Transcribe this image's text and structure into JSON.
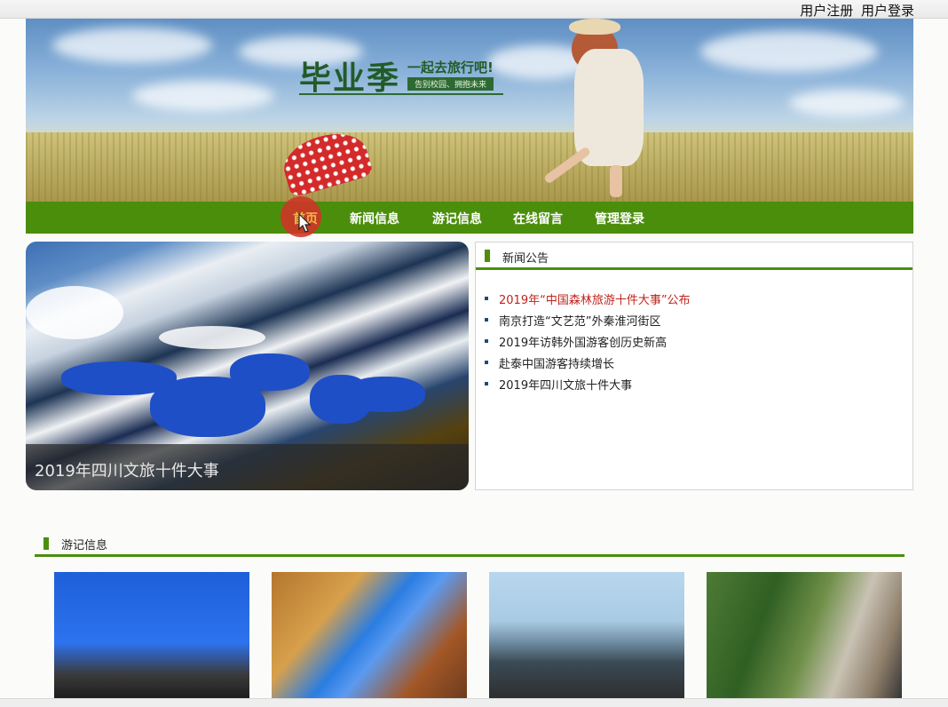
{
  "top": {
    "links": [
      "用户注册",
      "用户登录"
    ]
  },
  "banner": {
    "logo_main": "毕业季",
    "logo_sub": "一起去旅行吧!",
    "logo_tag": "告别校园、拥抱未来"
  },
  "nav": {
    "items": [
      "首页",
      "新闻信息",
      "游记信息",
      "在线留言",
      "管理登录"
    ],
    "active": "首页"
  },
  "hero": {
    "caption": "2019年四川文旅十件大事"
  },
  "news": {
    "title": "新闻公告",
    "items": [
      "2019年“中国森林旅游十件大事”公布",
      "南京打造“文艺范”外秦淮河街区",
      "2019年访韩外国游客创历史新高",
      "赴泰中国游客持续增长",
      "2019年四川文旅十件大事"
    ]
  },
  "travel": {
    "title": "游记信息"
  },
  "colors": {
    "accent_green": "#4b8e0c",
    "hot_red": "#c0241a"
  }
}
